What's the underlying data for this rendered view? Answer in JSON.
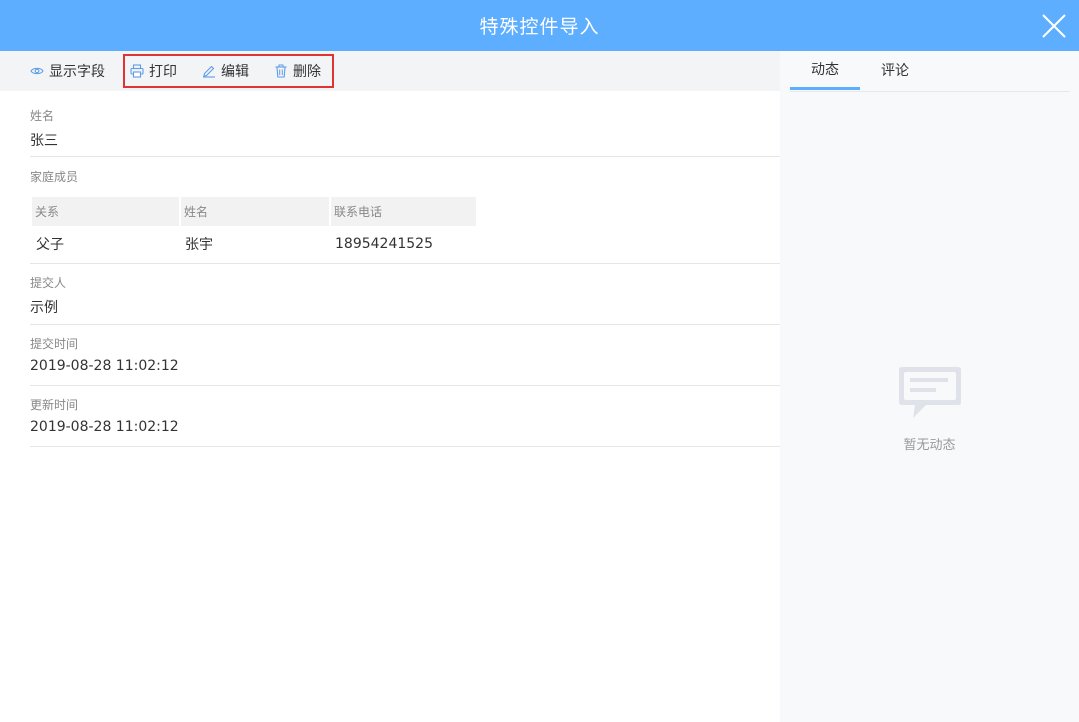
{
  "header": {
    "title": "特殊控件导入"
  },
  "toolbar": {
    "show_fields": "显示字段",
    "print": "打印",
    "edit": "编辑",
    "delete": "删除"
  },
  "fields": {
    "name": {
      "label": "姓名",
      "value": "张三"
    },
    "family": {
      "label": "家庭成员",
      "columns": [
        "关系",
        "姓名",
        "联系电话"
      ],
      "rows": [
        [
          "父子",
          "张宇",
          "18954241525"
        ]
      ]
    },
    "submitter": {
      "label": "提交人",
      "value": "示例"
    },
    "submit_time": {
      "label": "提交时间",
      "value": "2019-08-28 11:02:12"
    },
    "update_time": {
      "label": "更新时间",
      "value": "2019-08-28 11:02:12"
    }
  },
  "side": {
    "tabs": [
      "动态",
      "评论"
    ],
    "active_tab": "动态",
    "empty_text": "暂无动态"
  },
  "colors": {
    "header": "#5daeff",
    "highlight": "#e03434",
    "accent": "#5daeff"
  },
  "icons": {
    "show_fields": "eye-icon",
    "print": "printer-icon",
    "edit": "pencil-icon",
    "delete": "trash-icon",
    "close": "close-icon",
    "empty": "chat-bubble-icon"
  }
}
